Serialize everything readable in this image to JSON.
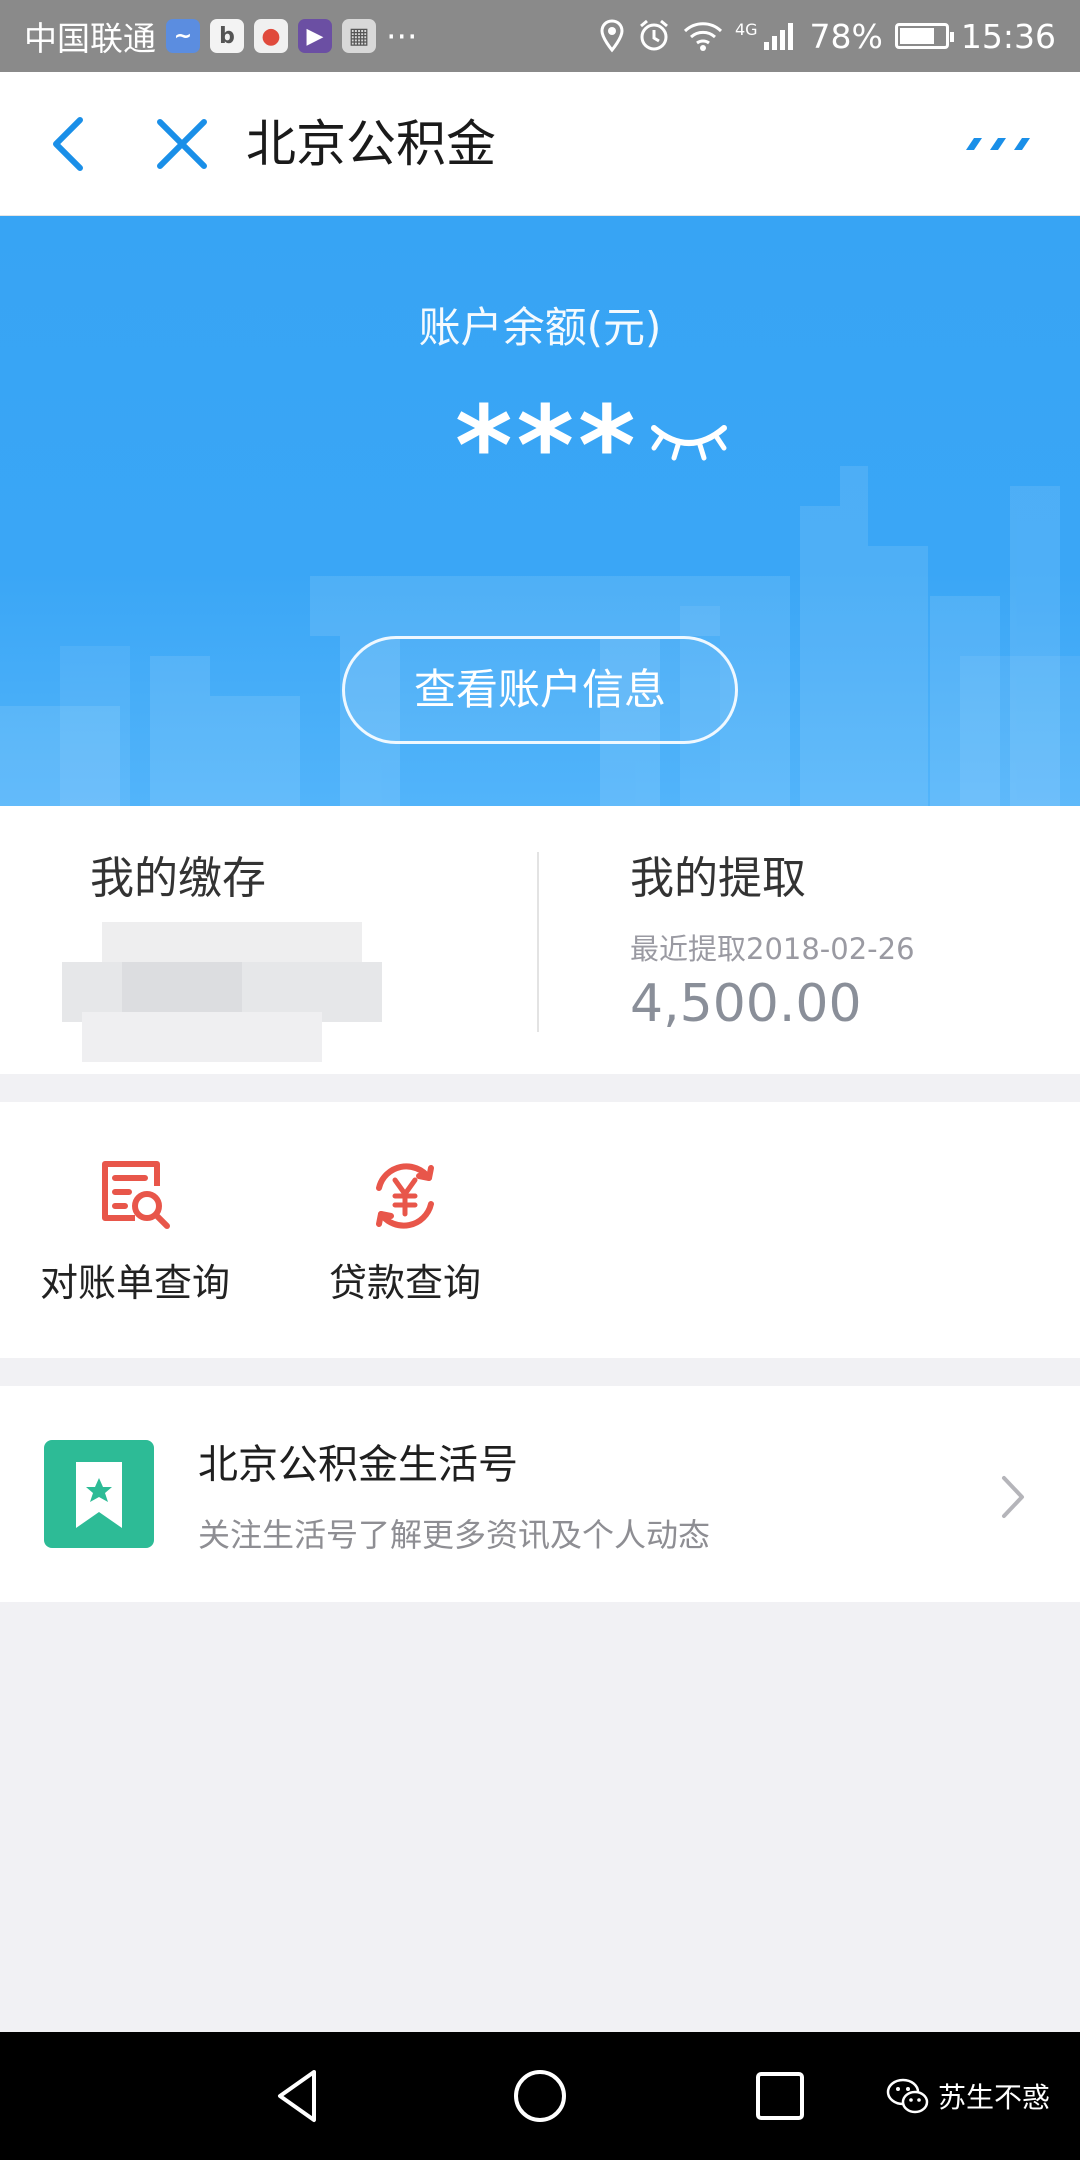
{
  "status_bar": {
    "carrier": "中国联通",
    "more_notifications": "···",
    "network": "4G",
    "battery": "78%",
    "battery_level": 0.78,
    "time": "15:36",
    "notification_icons": [
      "alipay-icon",
      "baidu-icon",
      "map-icon",
      "video-icon",
      "app-icon"
    ]
  },
  "header": {
    "title": "北京公积金"
  },
  "hero": {
    "balance_label": "账户余额(元)",
    "balance_masked": "***",
    "account_info_button": "查看账户信息"
  },
  "stats": {
    "deposit_heading": "我的缴存",
    "withdraw_heading": "我的提取",
    "recent_withdraw": "最近提取2018-02-26",
    "withdraw_amount": "4,500.00"
  },
  "services": [
    {
      "label": "对账单查询",
      "icon": "statement-search-icon"
    },
    {
      "label": "贷款查询",
      "icon": "loan-yuan-icon"
    }
  ],
  "life_account": {
    "title": "北京公积金生活号",
    "subtitle": "关注生活号了解更多资讯及个人动态"
  },
  "watermark": {
    "text": "苏生不惑"
  },
  "colors": {
    "primary_blue": "#3aa6f6",
    "accent_red": "#e8564a",
    "life_green": "#2dbb96"
  }
}
